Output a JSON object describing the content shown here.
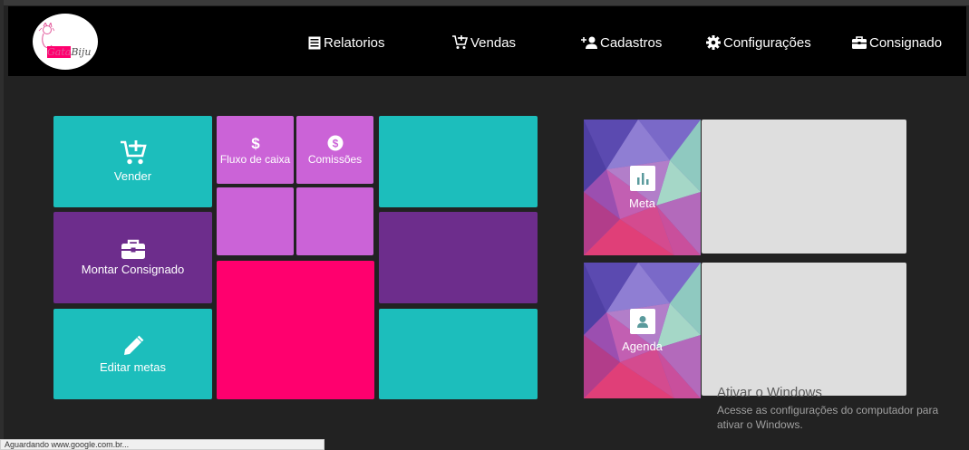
{
  "brand": {
    "logo_text_a": "Gata",
    "logo_text_b": "Biju"
  },
  "nav": {
    "items": [
      {
        "label": "Relatorios",
        "icon": "list-icon"
      },
      {
        "label": "Vendas",
        "icon": "cart-plus-icon"
      },
      {
        "label": "Cadastros",
        "icon": "user-plus-icon"
      },
      {
        "label": "Configurações",
        "icon": "gear-icon"
      },
      {
        "label": "Consignado",
        "icon": "briefcase-icon"
      }
    ]
  },
  "tiles": {
    "vender": {
      "label": "Vender",
      "icon": "cart-plus-icon"
    },
    "fluxo": {
      "label": "Fluxo de caixa",
      "icon": "dollar-icon"
    },
    "comissoes": {
      "label": "Comissões",
      "icon": "dollar-circle-icon"
    },
    "montar": {
      "label": "Montar Consignado",
      "icon": "briefcase-icon"
    },
    "editar": {
      "label": "Editar metas",
      "icon": "pencil-icon"
    }
  },
  "side": {
    "meta": {
      "label": "Meta",
      "icon": "bar-chart-icon"
    },
    "agenda": {
      "label": "Agenda",
      "icon": "contact-icon"
    }
  },
  "watermark": {
    "title": "Ativar o Windows",
    "subtitle": "Acesse as configurações do computador para ativar o Windows."
  },
  "status": {
    "text": "Aguardando www.google.com.br..."
  },
  "colors": {
    "teal": "#1cbebc",
    "purple": "#6d2d8c",
    "violet": "#cb63d7",
    "pink": "#ff006e",
    "navbar": "#000000",
    "background": "#222222"
  }
}
